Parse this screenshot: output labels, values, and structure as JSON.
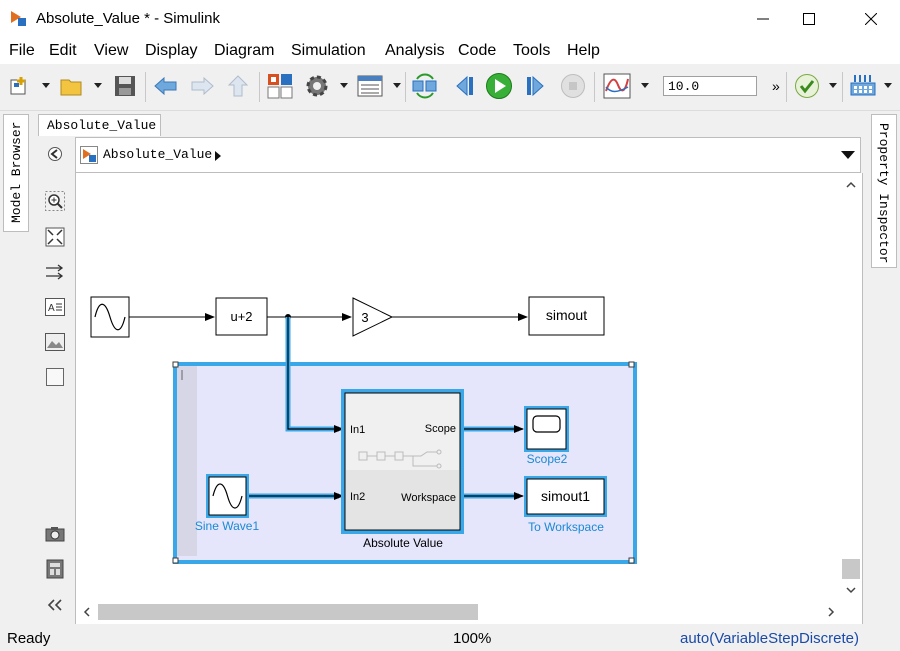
{
  "window": {
    "title": "Absolute_Value * - Simulink",
    "controls": {
      "minimize": "minimize-icon",
      "maximize": "maximize-icon",
      "close": "close-icon"
    }
  },
  "menu": [
    "File",
    "Edit",
    "View",
    "Display",
    "Diagram",
    "Simulation",
    "Analysis",
    "Code",
    "Tools",
    "Help"
  ],
  "toolbar": {
    "stop_time": "10.0",
    "more": "»",
    "icons": [
      "new-model-icon",
      "open-icon",
      "save-icon",
      "back-icon",
      "forward-icon",
      "up-icon",
      "library-browser-icon",
      "model-config-icon",
      "model-explorer-icon",
      "update-diagram-icon",
      "step-back-icon",
      "run-icon",
      "step-forward-icon",
      "stop-icon",
      "data-inspector-icon",
      "check-icon",
      "build-icon"
    ]
  },
  "side_tabs": {
    "left": "Model Browser",
    "right": "Property Inspector"
  },
  "editor": {
    "tab_label": "Absolute_Value",
    "breadcrumb": "Absolute_Value"
  },
  "palette_icons": [
    "hide-show-icon",
    "zoom-icon",
    "fit-view-icon",
    "arrows-icon",
    "annotation-icon",
    "image-icon",
    "area-icon",
    "camera-icon",
    "report-icon",
    "collapse-icon"
  ],
  "diagram": {
    "blocks": {
      "gain_value": "3",
      "fcn_expr": "u+2",
      "simout": "simout",
      "subsystem_ports": {
        "in1": "In1",
        "in2": "In2",
        "out1": "Scope",
        "out2": "Workspace"
      },
      "subsystem_name": "Absolute Value",
      "scope_name": "Scope2",
      "sine_name": "Sine Wave1",
      "workspace_block": "simout1",
      "workspace_name": "To Workspace"
    },
    "colors": {
      "selection": "#3aa8e8",
      "area_fill": "#e5e5fb",
      "label_blue": "#1a8ad4"
    }
  },
  "status": {
    "left": "Ready",
    "zoom": "100%",
    "solver": "auto(VariableStepDiscrete)"
  }
}
